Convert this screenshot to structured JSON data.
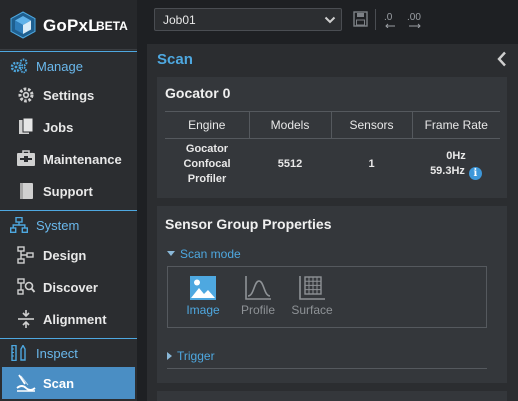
{
  "brand": {
    "name": "GoPxL",
    "badge": "BETA",
    "accent": "#4ea8e0"
  },
  "sidebar": {
    "sections": [
      {
        "title": "Manage",
        "icon": "gears-icon",
        "items": [
          {
            "label": "Settings",
            "icon": "gear-icon"
          },
          {
            "label": "Jobs",
            "icon": "document-icon"
          },
          {
            "label": "Maintenance",
            "icon": "toolbox-icon"
          },
          {
            "label": "Support",
            "icon": "book-icon"
          }
        ]
      },
      {
        "title": "System",
        "icon": "network-icon",
        "items": [
          {
            "label": "Design",
            "icon": "flow-icon"
          },
          {
            "label": "Discover",
            "icon": "search-network-icon"
          },
          {
            "label": "Alignment",
            "icon": "alignment-icon"
          }
        ]
      },
      {
        "title": "Inspect",
        "icon": "inspect-icon",
        "items": [
          {
            "label": "Scan",
            "icon": "scan-icon",
            "active": true
          }
        ]
      }
    ]
  },
  "toolbar": {
    "job": "Job01",
    "save_icon": "save-icon",
    "decimal_decrease_label": ".0",
    "decimal_increase_label": ".00"
  },
  "scan_panel": {
    "title": "Scan",
    "collapse_icon": "chevron-left-icon",
    "sensor_card": {
      "title": "Gocator 0",
      "columns": [
        "Engine",
        "Models",
        "Sensors",
        "Frame Rate"
      ],
      "row": {
        "engine": "Gocator Confocal Profiler",
        "models": "5512",
        "sensors": "1",
        "frame_rate": "0Hz",
        "frame_rate_max": "59.3Hz"
      }
    },
    "group_card": {
      "title": "Sensor Group Properties",
      "scan_mode_label": "Scan mode",
      "modes": [
        {
          "label": "Image",
          "icon": "image-icon",
          "selected": true
        },
        {
          "label": "Profile",
          "icon": "profile-icon",
          "selected": false
        },
        {
          "label": "Surface",
          "icon": "surface-icon",
          "selected": false
        }
      ],
      "trigger_label": "Trigger"
    }
  },
  "colors": {
    "active_nav": "#4a8ec4",
    "section_text": "#6ab8ec",
    "info_icon": "#3d97d9"
  }
}
